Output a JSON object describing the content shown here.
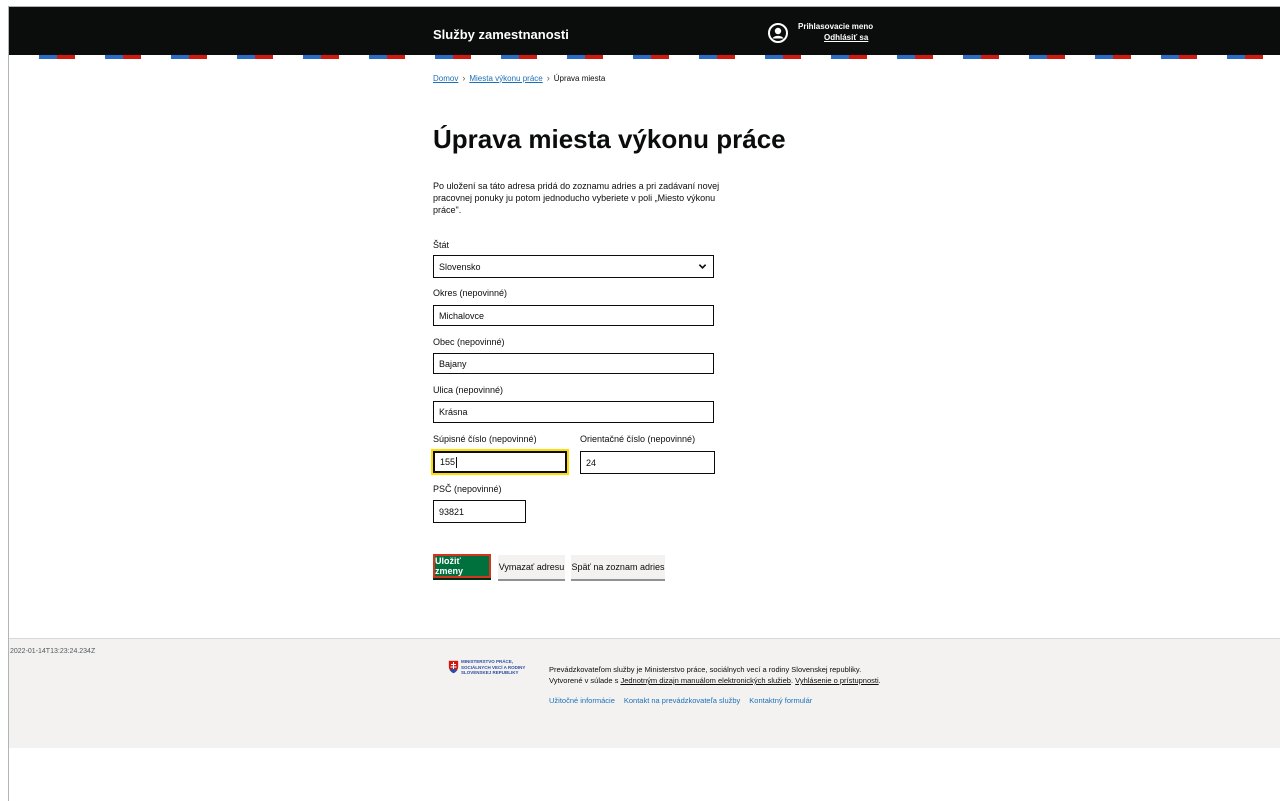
{
  "header": {
    "brand": "Služby zamestnanosti",
    "user_label": "Prihlasovacie meno",
    "logout": "Odhlásiť sa"
  },
  "breadcrumb": {
    "home": "Domov",
    "places": "Miesta výkonu práce",
    "current": "Úprava miesta"
  },
  "page": {
    "title": "Úprava miesta výkonu práce",
    "intro": "Po uložení sa táto adresa pridá do zoznamu adries a pri zadávaní novej pracovnej ponuky ju potom jednoducho vyberiete v poli „Miesto výkonu práce\"."
  },
  "form": {
    "country_label": "Štát",
    "country_value": "Slovensko",
    "district_label": "Okres (nepovinné)",
    "district_value": "Michalovce",
    "municipality_label": "Obec (nepovinné)",
    "municipality_value": "Bajany",
    "street_label": "Ulica (nepovinné)",
    "street_value": "Krásna",
    "supisne_label": "Súpisné číslo (nepovinné)",
    "supisne_value": "155",
    "orientacne_label": "Orientačné číslo (nepovinné)",
    "orientacne_value": "24",
    "psc_label": "PSČ (nepovinné)",
    "psc_value": "93821"
  },
  "buttons": {
    "save": "Uložiť zmeny",
    "delete": "Vymazať adresu",
    "back": "Späť na zoznam adries"
  },
  "footer": {
    "timestamp": "2022-01-14T13:23:24.234Z",
    "ministry_logo": "MINISTERSTVO PRÁCE, SOCIÁLNYCH VECÍ A RODINY SLOVENSKEJ REPUBLIKY",
    "text_pre": "Prevádzkovateľom služby je Ministerstvo práce, sociálnych vecí a rodiny Slovenskej republiky. Vytvorené v súlade s ",
    "manual_link": "Jednotným dizajn manuálom elektronických služieb",
    "text_mid": ". ",
    "accessibility_link": "Vyhlásenie o prístupnosti",
    "text_end": ".",
    "links": [
      "Užitočné informácie",
      "Kontakt na prevádzkovateľa služby",
      "Kontaktný formulár"
    ]
  },
  "colors": {
    "header_bg": "#0b0c0c",
    "primary_button": "#00703c",
    "link": "#1d70b8",
    "focus": "#ffdd00"
  }
}
